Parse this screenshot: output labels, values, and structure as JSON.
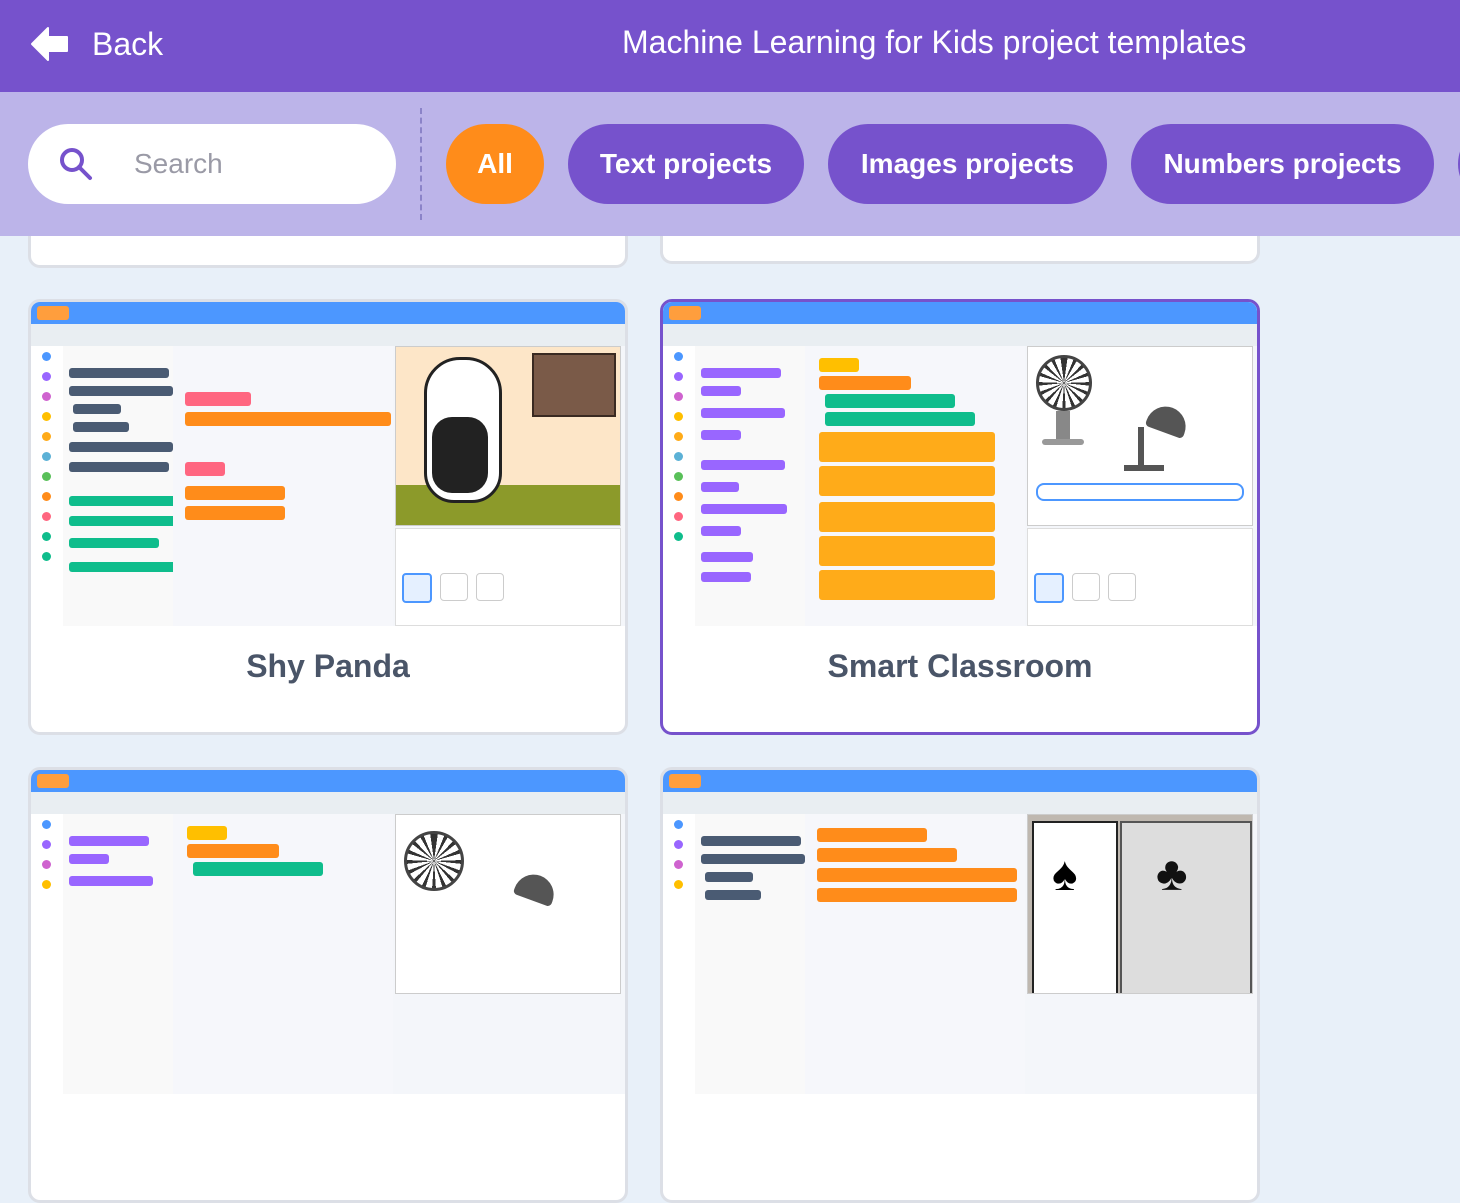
{
  "header": {
    "back_label": "Back",
    "title": "Machine Learning for Kids project templates",
    "background_color": "#7652cc"
  },
  "filters": {
    "search_placeholder": "Search",
    "chips": [
      {
        "label": "All",
        "active": true
      },
      {
        "label": "Text projects",
        "active": false
      },
      {
        "label": "Images projects",
        "active": false
      },
      {
        "label": "Numbers projects",
        "active": false
      }
    ],
    "active_color": "#ff8c1a",
    "chip_color": "#7652cc"
  },
  "cards": [
    {
      "title": "Shy Panda",
      "selected": false,
      "thumbnail": "panda-scratch-screenshot"
    },
    {
      "title": "Smart Classroom",
      "selected": true,
      "thumbnail": "fan-lamp-scratch-screenshot"
    },
    {
      "title": "",
      "selected": false,
      "thumbnail": "fan-scratch-screenshot"
    },
    {
      "title": "",
      "selected": false,
      "thumbnail": "cards-scratch-screenshot"
    }
  ],
  "icons": {
    "back": "arrow-left-icon",
    "search": "search-icon"
  }
}
